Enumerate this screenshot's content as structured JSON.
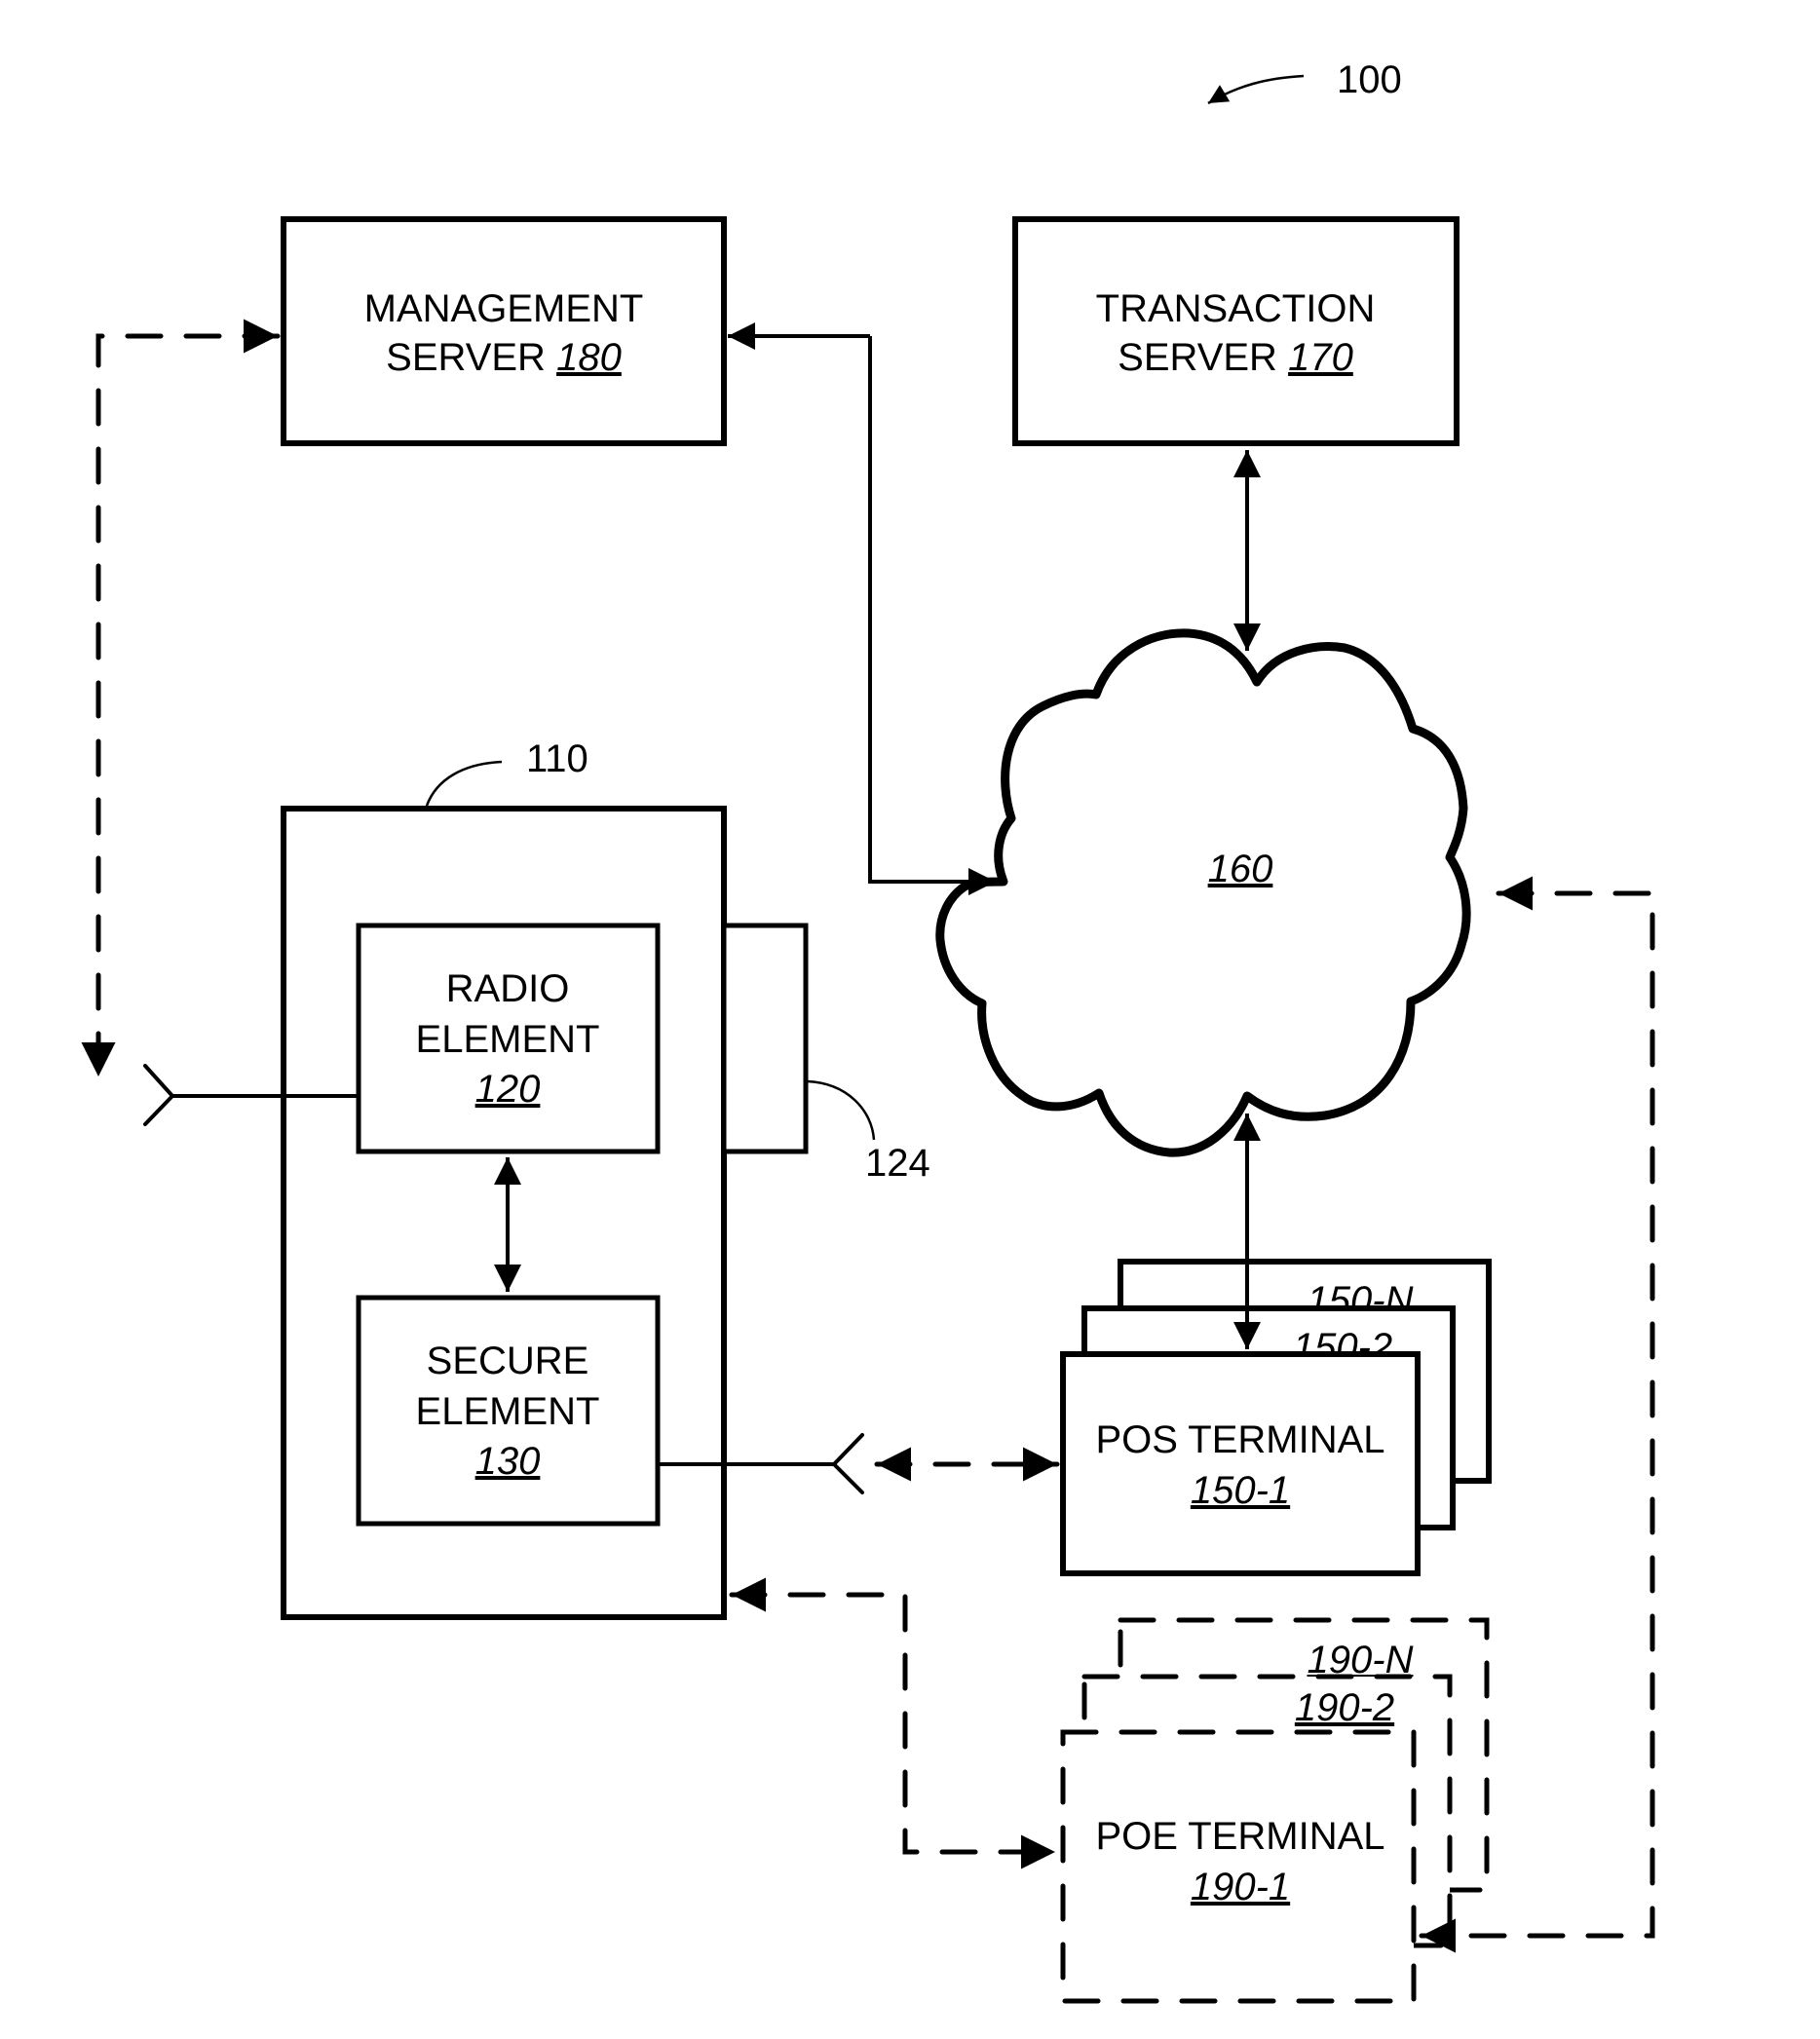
{
  "figure": {
    "reference": "100",
    "colors": {
      "ink": "#000000",
      "background": "#ffffff"
    }
  },
  "management_server": {
    "line1": "MANAGEMENT",
    "line2": "SERVER",
    "ref": "180"
  },
  "transaction_server": {
    "line1": "TRANSACTION",
    "line2": "SERVER",
    "ref": "170"
  },
  "network": {
    "ref": "160"
  },
  "device": {
    "ref": "110",
    "tab_ref": "124",
    "radio_element": {
      "line1": "RADIO",
      "line2": "ELEMENT",
      "ref": "120"
    },
    "secure_element": {
      "line1": "SECURE",
      "line2": "ELEMENT",
      "ref": "130"
    }
  },
  "pos_terminals": {
    "label": "POS TERMINAL",
    "refs": [
      "150-1",
      "150-2",
      "150-N"
    ]
  },
  "poe_terminals": {
    "label": "POE TERMINAL",
    "refs": [
      "190-1",
      "190-2",
      "190-N"
    ]
  }
}
